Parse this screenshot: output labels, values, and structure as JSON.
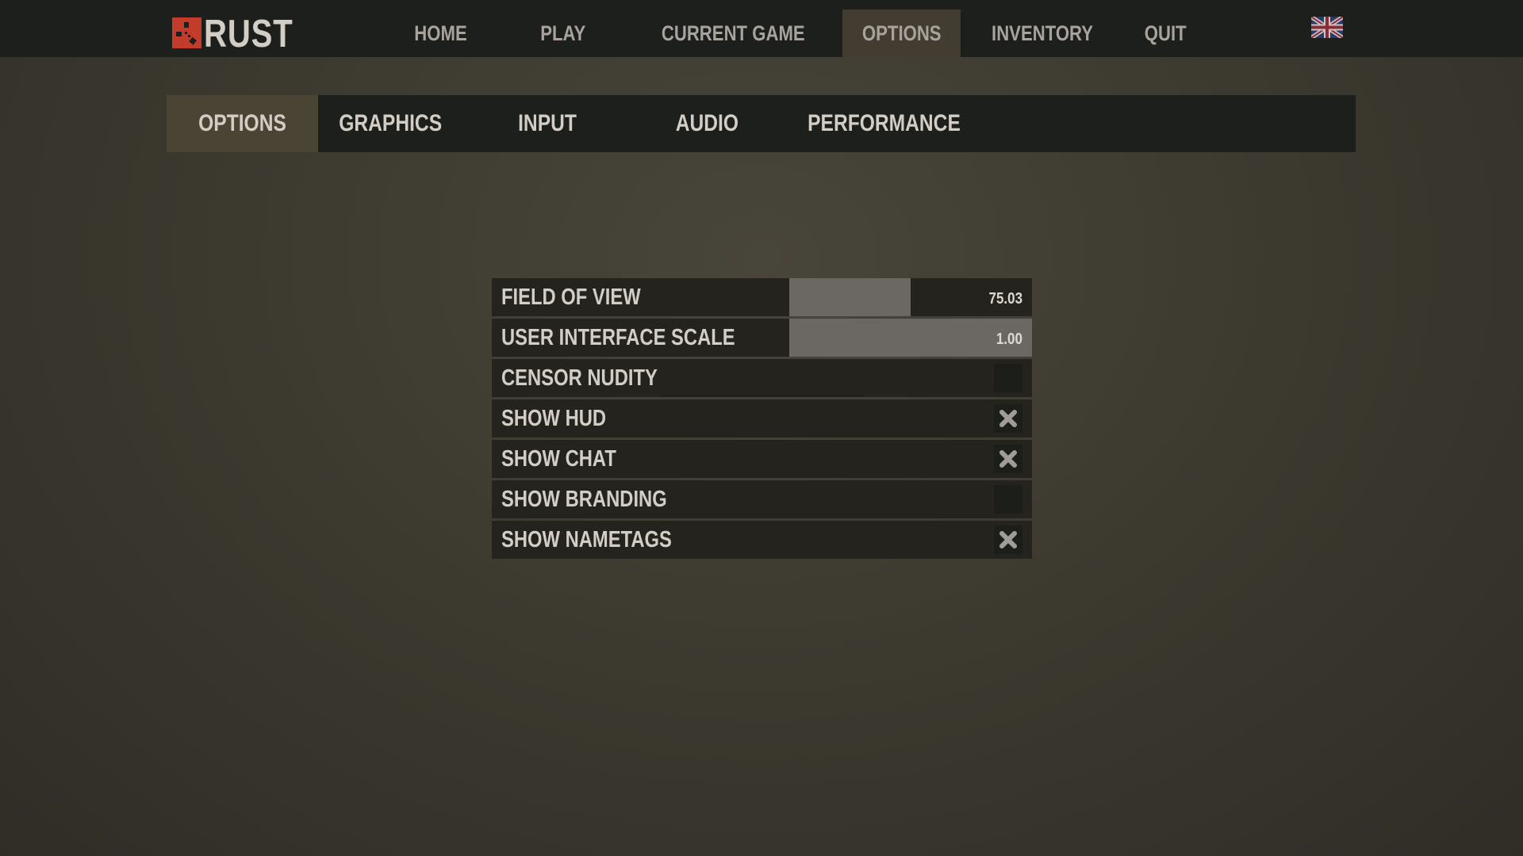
{
  "app": {
    "logo_text": "RUST"
  },
  "topnav": {
    "items": [
      {
        "label": "HOME",
        "active": false
      },
      {
        "label": "PLAY",
        "active": false
      },
      {
        "label": "CURRENT GAME",
        "active": false
      },
      {
        "label": "OPTIONS",
        "active": true
      },
      {
        "label": "INVENTORY",
        "active": false
      },
      {
        "label": "QUIT",
        "active": false
      }
    ],
    "language_icon": "uk-flag-icon"
  },
  "subnav": {
    "items": [
      {
        "label": "OPTIONS",
        "active": true
      },
      {
        "label": "GRAPHICS",
        "active": false
      },
      {
        "label": "INPUT",
        "active": false
      },
      {
        "label": "AUDIO",
        "active": false
      },
      {
        "label": "PERFORMANCE",
        "active": false
      }
    ]
  },
  "settings": {
    "sliders": [
      {
        "label": "FIELD OF VIEW",
        "value": "75.03",
        "fill_fraction": 0.5
      },
      {
        "label": "USER INTERFACE SCALE",
        "value": "1.00",
        "fill_fraction": 1.0
      }
    ],
    "toggles": [
      {
        "label": "CENSOR NUDITY",
        "checked": false
      },
      {
        "label": "SHOW HUD",
        "checked": true
      },
      {
        "label": "SHOW CHAT",
        "checked": true
      },
      {
        "label": "SHOW BRANDING",
        "checked": false
      },
      {
        "label": "SHOW NAMETAGS",
        "checked": true
      }
    ]
  },
  "colors": {
    "brand_red": "#c23b2b",
    "nav_bg": "#1c1f1b",
    "active_tab": "#423d30",
    "text": "#d2cdc5",
    "slider_fill": "#6b6863"
  }
}
